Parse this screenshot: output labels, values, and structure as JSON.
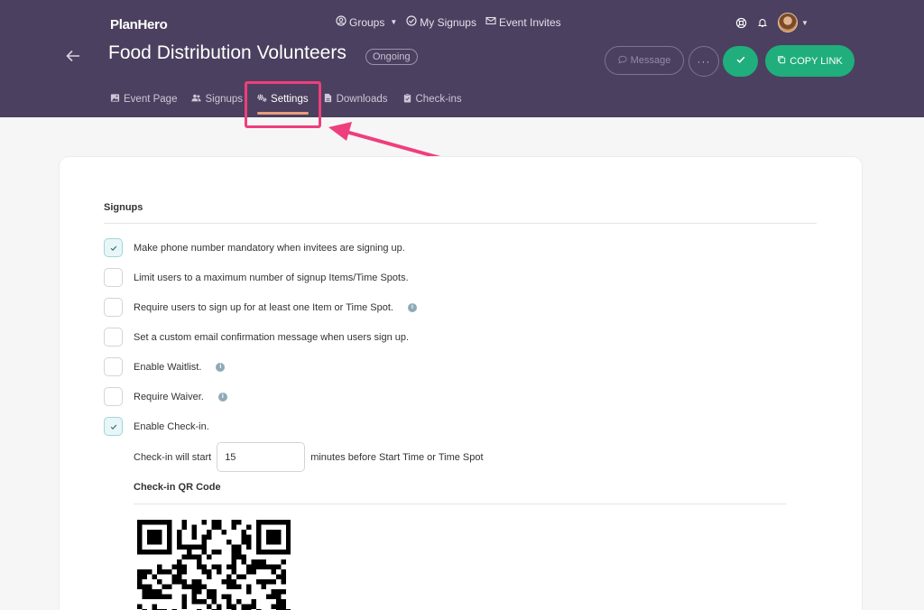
{
  "app": {
    "logo": "PlanHero"
  },
  "topnav": {
    "groups": "Groups",
    "my_signups": "My Signups",
    "event_invites": "Event Invites"
  },
  "event": {
    "title": "Food Distribution Volunteers",
    "status": "Ongoing"
  },
  "actions": {
    "message": "Message",
    "more": "···",
    "copy_link": "COPY LINK"
  },
  "tabs": [
    {
      "label": "Event Page",
      "icon": "image-icon"
    },
    {
      "label": "Signups",
      "icon": "users-icon"
    },
    {
      "label": "Settings",
      "icon": "gears-icon",
      "active": true
    },
    {
      "label": "Downloads",
      "icon": "file-icon"
    },
    {
      "label": "Check-ins",
      "icon": "clipboard-icon"
    }
  ],
  "settings": {
    "section_title": "Signups",
    "options": [
      {
        "label": "Make phone number mandatory when invitees are signing up.",
        "checked": true,
        "info": false
      },
      {
        "label": "Limit users to a maximum number of signup Items/Time Spots.",
        "checked": false,
        "info": false
      },
      {
        "label": "Require users to sign up for at least one Item or Time Spot.",
        "checked": false,
        "info": true
      },
      {
        "label": "Set a custom email confirmation message when users sign up.",
        "checked": false,
        "info": false
      },
      {
        "label": "Enable Waitlist.",
        "checked": false,
        "info": true
      },
      {
        "label": "Require Waiver.",
        "checked": false,
        "info": true
      },
      {
        "label": "Enable Check-in.",
        "checked": true,
        "info": false
      }
    ],
    "checkin": {
      "prefix": "Check-in will start",
      "minutes": "15",
      "suffix": "minutes before Start Time or Time Spot"
    },
    "qr_title": "Check-in QR Code"
  },
  "colors": {
    "header_bg": "#4b405f",
    "accent_green": "#1fae7c",
    "highlight_pink": "#ef3e7c",
    "active_tab_underline": "#e79e7c"
  }
}
